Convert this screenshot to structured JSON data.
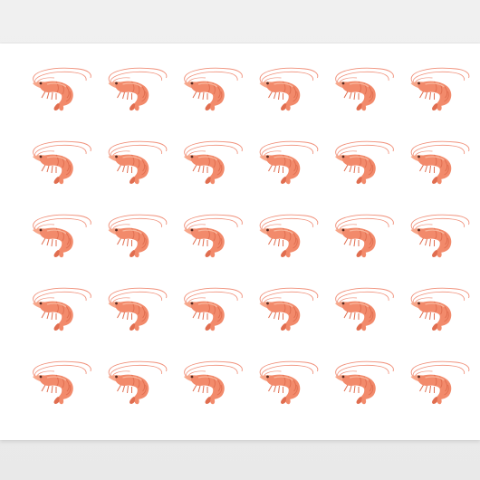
{
  "product": {
    "type": "wrapping-paper-sheet",
    "pattern_motif": "shrimp",
    "grid": {
      "rows": 5,
      "columns": 6
    }
  },
  "colors": {
    "background": "#ececec",
    "paper": "#ffffff",
    "shrimp_body": "#f28a6b",
    "shrimp_light": "#f7a689",
    "shrimp_dark": "#e06d4f",
    "antenna": "#f0907a",
    "eye": "#5a2a20"
  }
}
